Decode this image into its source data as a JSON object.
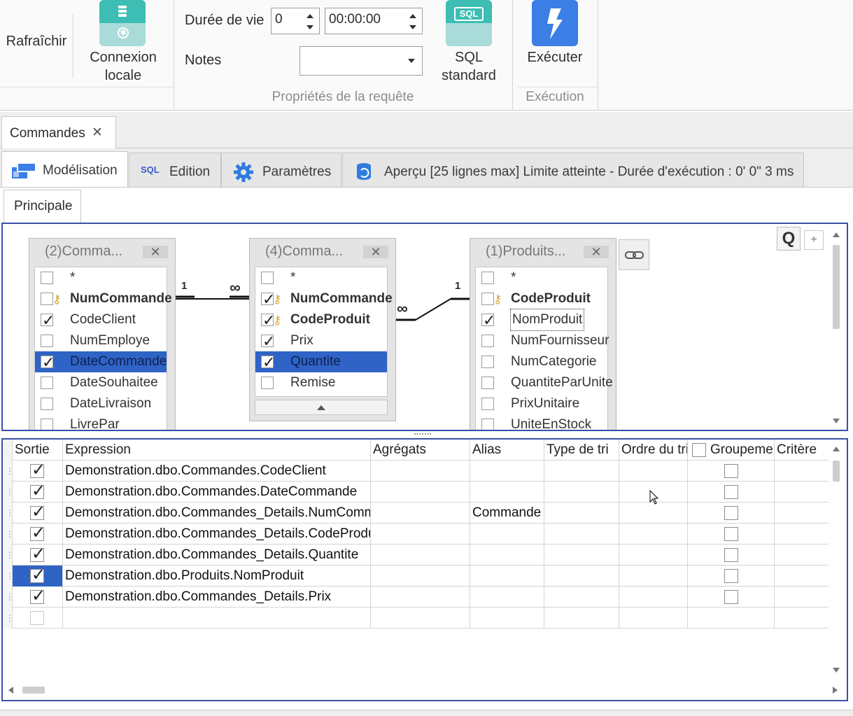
{
  "ribbon": {
    "refresh_label": "Rafraîchir",
    "local_conn_line1": "Connexion",
    "local_conn_line2": "locale",
    "duree_label": "Durée de vie",
    "duree_value": "0",
    "time_value": "00:00:00",
    "notes_label": "Notes",
    "notes_value": "",
    "sql_icon_text": "SQL",
    "sql_line1": "SQL",
    "sql_line2": "standard",
    "execute_label": "Exécuter",
    "group_props": "Propriétés de la requête",
    "group_exec": "Exécution"
  },
  "doc_tab": {
    "label": "Commandes",
    "close": "✕"
  },
  "subtabs": {
    "modelisation": "Modélisation",
    "sql_icon": "SQL",
    "edition": "Edition",
    "parametres": "Paramètres",
    "apercu": "Aperçu [25 lignes max] Limite atteinte - Durée d'exécution : 0' 0\" 3 ms"
  },
  "principale_tab": "Principale",
  "diagram": {
    "zoom_label": "Q",
    "zoom_plus": "+",
    "relation_labels": {
      "one_a": "1",
      "many_a": "∞",
      "many_b": "∞",
      "one_b": "1"
    },
    "tables": [
      {
        "title": "(2)Comma...",
        "fields": [
          {
            "name": "*",
            "checked": false,
            "key": false,
            "bold": false,
            "selected": false
          },
          {
            "name": "NumCommande",
            "checked": false,
            "key": true,
            "bold": true,
            "selected": false
          },
          {
            "name": "CodeClient",
            "checked": true,
            "key": false,
            "bold": false,
            "selected": false
          },
          {
            "name": "NumEmploye",
            "checked": false,
            "key": false,
            "bold": false,
            "selected": false
          },
          {
            "name": "DateCommande",
            "checked": true,
            "key": false,
            "bold": false,
            "selected": true
          },
          {
            "name": "DateSouhaitee",
            "checked": false,
            "key": false,
            "bold": false,
            "selected": false
          },
          {
            "name": "DateLivraison",
            "checked": false,
            "key": false,
            "bold": false,
            "selected": false
          },
          {
            "name": "LivrePar",
            "checked": false,
            "key": false,
            "bold": false,
            "selected": false
          }
        ]
      },
      {
        "title": "(4)Comma...",
        "fields": [
          {
            "name": "*",
            "checked": false,
            "key": false,
            "bold": false,
            "selected": false
          },
          {
            "name": "NumCommande",
            "checked": true,
            "key": true,
            "bold": true,
            "selected": false
          },
          {
            "name": "CodeProduit",
            "checked": true,
            "key": true,
            "bold": true,
            "selected": false
          },
          {
            "name": "Prix",
            "checked": true,
            "key": false,
            "bold": false,
            "selected": false
          },
          {
            "name": "Quantite",
            "checked": true,
            "key": false,
            "bold": false,
            "selected": true
          },
          {
            "name": "Remise",
            "checked": false,
            "key": false,
            "bold": false,
            "selected": false
          }
        ]
      },
      {
        "title": "(1)Produits...",
        "fields": [
          {
            "name": "*",
            "checked": false,
            "key": false,
            "bold": false,
            "selected": false
          },
          {
            "name": "CodeProduit",
            "checked": false,
            "key": true,
            "bold": true,
            "selected": false
          },
          {
            "name": "NomProduit",
            "checked": true,
            "key": false,
            "bold": false,
            "selected": false,
            "focused": true
          },
          {
            "name": "NumFournisseur",
            "checked": false,
            "key": false,
            "bold": false,
            "selected": false
          },
          {
            "name": "NumCategorie",
            "checked": false,
            "key": false,
            "bold": false,
            "selected": false
          },
          {
            "name": "QuantiteParUnite",
            "checked": false,
            "key": false,
            "bold": false,
            "selected": false
          },
          {
            "name": "PrixUnitaire",
            "checked": false,
            "key": false,
            "bold": false,
            "selected": false
          },
          {
            "name": "UniteEnStock",
            "checked": false,
            "key": false,
            "bold": false,
            "selected": false
          }
        ]
      }
    ]
  },
  "grid": {
    "headers": {
      "sortie": "Sortie",
      "expression": "Expression",
      "agregats": "Agrégats",
      "alias": "Alias",
      "type_tri": "Type de tri",
      "ordre_tri": "Ordre du tri",
      "groupement": "Groupement",
      "critere": "Critère"
    },
    "rows": [
      {
        "sortie": true,
        "expression": "Demonstration.dbo.Commandes.CodeClient",
        "alias": "",
        "selected": false
      },
      {
        "sortie": true,
        "expression": "Demonstration.dbo.Commandes.DateCommande",
        "alias": "",
        "selected": false
      },
      {
        "sortie": true,
        "expression": "Demonstration.dbo.Commandes_Details.NumCommande",
        "alias": "Commande",
        "selected": false
      },
      {
        "sortie": true,
        "expression": "Demonstration.dbo.Commandes_Details.CodeProduit",
        "alias": "",
        "selected": false
      },
      {
        "sortie": true,
        "expression": "Demonstration.dbo.Commandes_Details.Quantite",
        "alias": "",
        "selected": false
      },
      {
        "sortie": true,
        "expression": "Demonstration.dbo.Produits.NomProduit",
        "alias": "",
        "selected": true
      },
      {
        "sortie": true,
        "expression": "Demonstration.dbo.Commandes_Details.Prix",
        "alias": "",
        "selected": false
      },
      {
        "sortie": false,
        "expression": "",
        "alias": "",
        "selected": false,
        "empty": true
      }
    ]
  },
  "colors": {
    "accent_blue": "#2f63c5",
    "panel_border": "#3c4fa8",
    "teal_icon": "#3dbdb4",
    "execute_icon": "#3b7ee6"
  },
  "icons": [
    "database-icon",
    "link-icon",
    "gear-icon",
    "lightning-icon",
    "sql-icon",
    "modelisation-icon",
    "key-icon",
    "close-icon",
    "mouse-cursor-icon"
  ]
}
